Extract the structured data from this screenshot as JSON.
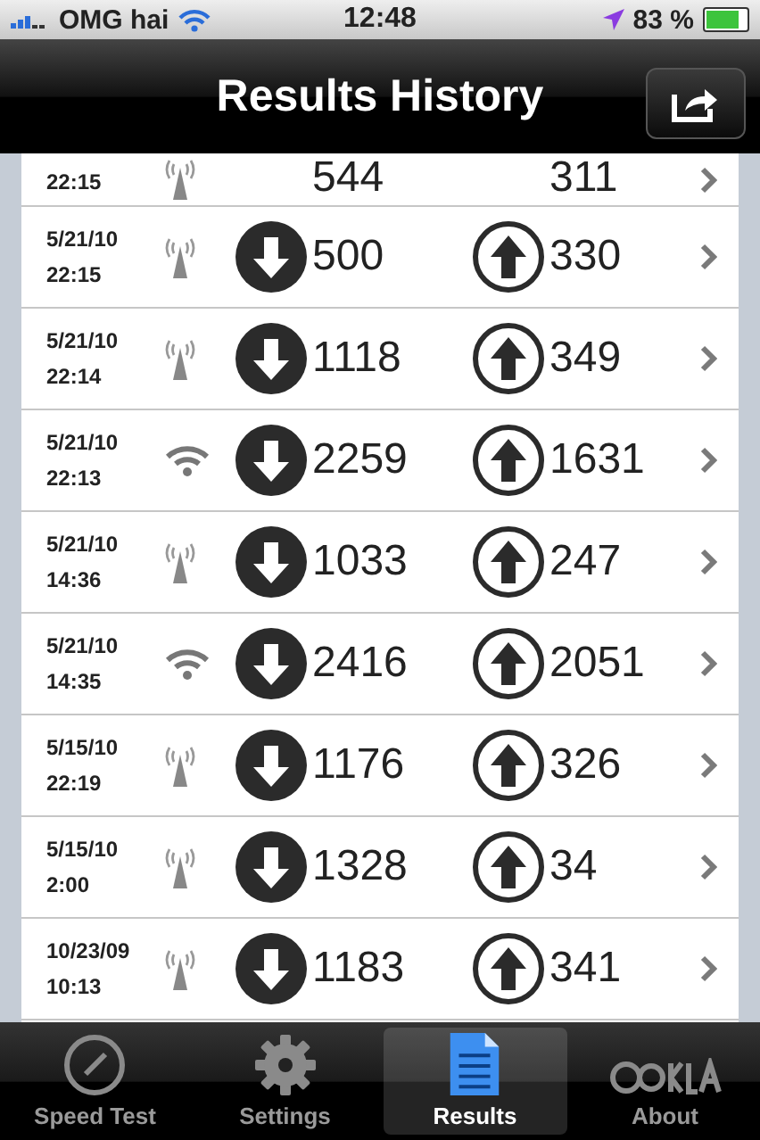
{
  "status_bar": {
    "carrier": "OMG hai",
    "time": "12:48",
    "battery": "83 %"
  },
  "nav_bar": {
    "title": "Results History"
  },
  "results": [
    {
      "kind": "partial",
      "time": "22:15",
      "network": {
        "kind": "cell"
      },
      "download": "544",
      "upload": "311"
    },
    {
      "kind": "full",
      "date": "5/21/10",
      "time": "22:15",
      "network": {
        "kind": "cell"
      },
      "download": "500",
      "upload": "330"
    },
    {
      "kind": "full",
      "date": "5/21/10",
      "time": "22:14",
      "network": {
        "kind": "cell"
      },
      "download": "1118",
      "upload": "349"
    },
    {
      "kind": "full",
      "date": "5/21/10",
      "time": "22:13",
      "network": {
        "kind": "wifi"
      },
      "download": "2259",
      "upload": "1631"
    },
    {
      "kind": "full",
      "date": "5/21/10",
      "time": "14:36",
      "network": {
        "kind": "cell"
      },
      "download": "1033",
      "upload": "247"
    },
    {
      "kind": "full",
      "date": "5/21/10",
      "time": "14:35",
      "network": {
        "kind": "wifi"
      },
      "download": "2416",
      "upload": "2051"
    },
    {
      "kind": "full",
      "date": "5/15/10",
      "time": "22:19",
      "network": {
        "kind": "cell"
      },
      "download": "1176",
      "upload": "326"
    },
    {
      "kind": "full",
      "date": "5/15/10",
      "time": "2:00",
      "network": {
        "kind": "cell"
      },
      "download": "1328",
      "upload": "34"
    },
    {
      "kind": "full",
      "date": "10/23/09",
      "time": "10:13",
      "network": {
        "kind": "cell"
      },
      "download": "1183",
      "upload": "341"
    }
  ],
  "tab_bar": [
    {
      "label": "Speed Test",
      "selected": false
    },
    {
      "label": "Settings",
      "selected": false
    },
    {
      "label": "Results",
      "selected": true
    },
    {
      "label": "About",
      "selected": false
    }
  ]
}
